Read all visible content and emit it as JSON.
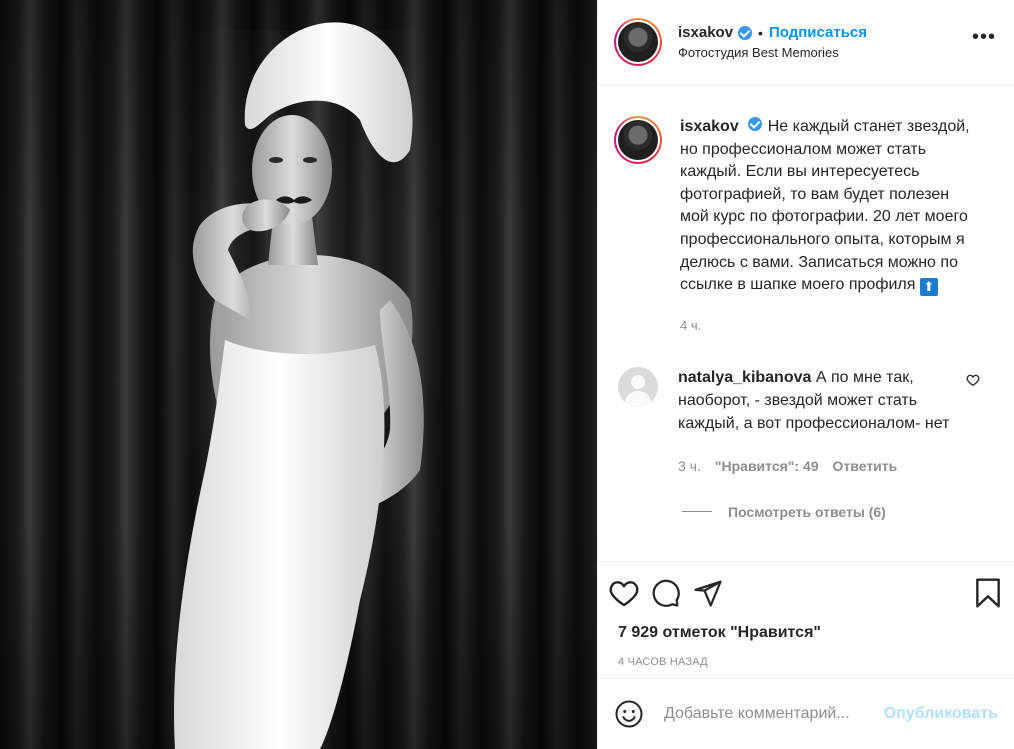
{
  "post": {
    "author": "isxakov",
    "follow_label": "Подписаться",
    "dot": "•",
    "location": "Фотостудия Best Memories",
    "more_label": "•••"
  },
  "caption": {
    "username": "isxakov",
    "text": "Не каждый станет звездой, но профессионалом может стать каждый. Если вы интересуетесь фотографией, то вам будет полезен мой курс по фотографии. 20 лет моего профессионального опыта, которым я делюсь с вами. Записаться можно по ссылке в шапке моего профиля",
    "emoji": "⬆",
    "time": "4 ч."
  },
  "comments": [
    {
      "username": "natalya_kibanova",
      "text": "А по мне так, наоборот, - звездой может стать каждый, а вот профессионалом- нет",
      "time": "3 ч.",
      "likes": "\"Нравится\": 49",
      "reply_label": "Ответить",
      "view_replies": "Посмотреть ответы (6)"
    }
  ],
  "likes_text": "7 929 отметок \"Нравится\"",
  "posted_ago": "4 часов назад",
  "add_comment": {
    "placeholder": "Добавьте комментарий...",
    "publish_label": "Опубликовать"
  },
  "icons": {
    "like": "heart-icon",
    "comment": "comment-bubble-icon",
    "share": "paper-plane-icon",
    "save": "bookmark-icon",
    "emoji": "smile-icon",
    "comment_like": "heart-small-icon",
    "verified": "verified-badge-icon"
  },
  "colors": {
    "follow": "#0095f6",
    "verified": "#3897f0",
    "publish_disabled": "#b2dffc",
    "muted": "#8e8e8e"
  }
}
